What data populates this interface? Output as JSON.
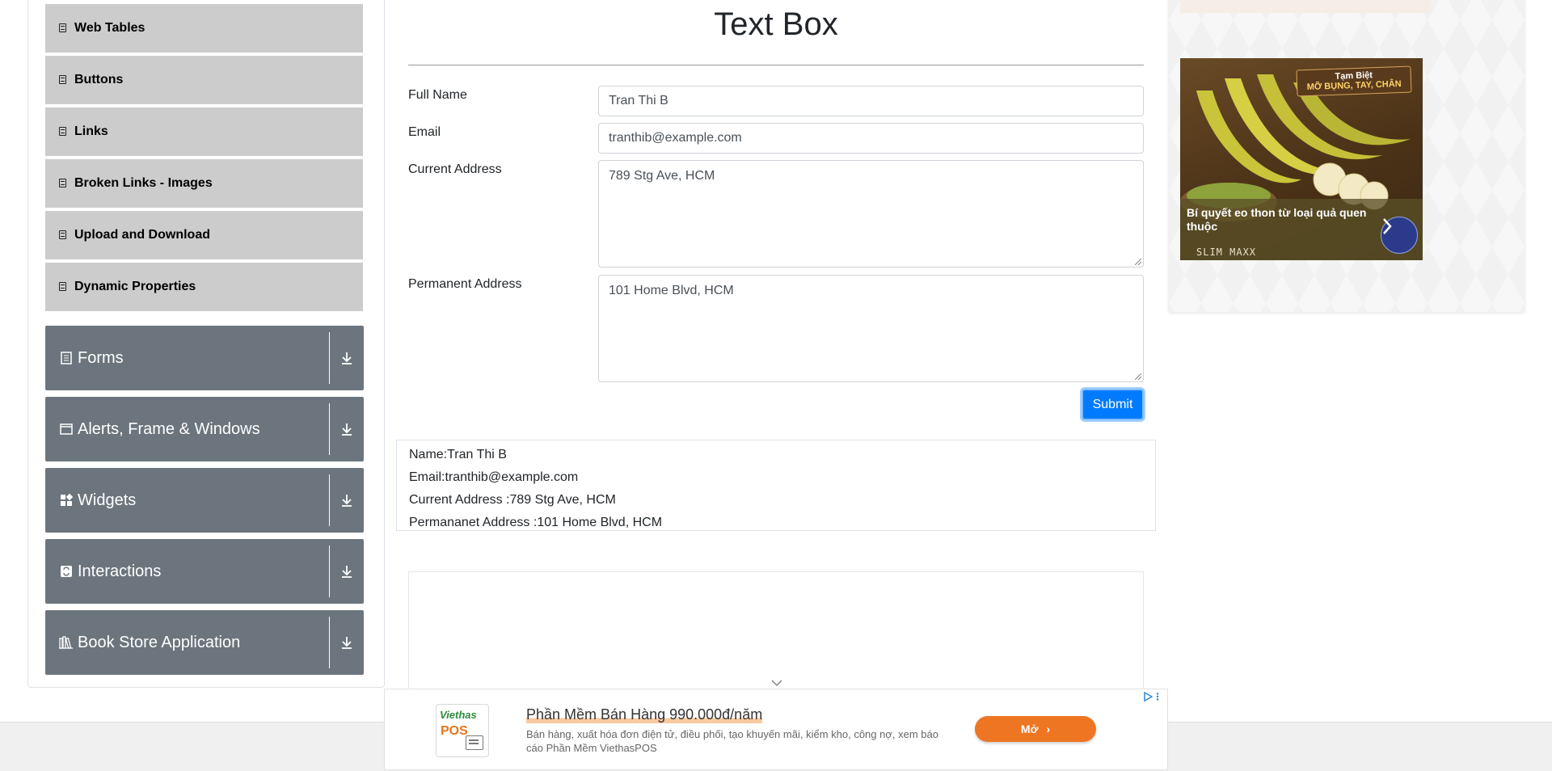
{
  "sidebar": {
    "sub_items": [
      {
        "label": "Web Tables",
        "icon": "element-icon"
      },
      {
        "label": "Buttons",
        "icon": "element-icon"
      },
      {
        "label": "Links",
        "icon": "element-icon"
      },
      {
        "label": "Broken Links - Images",
        "icon": "element-icon"
      },
      {
        "label": "Upload and Download",
        "icon": "element-icon"
      },
      {
        "label": "Dynamic Properties",
        "icon": "element-icon"
      }
    ],
    "groups": [
      {
        "label": "Forms",
        "icon": "document-icon"
      },
      {
        "label": "Alerts, Frame & Windows",
        "icon": "window-icon"
      },
      {
        "label": "Widgets",
        "icon": "widgets-icon"
      },
      {
        "label": "Interactions",
        "icon": "interactions-icon"
      },
      {
        "label": "Book Store Application",
        "icon": "books-icon"
      }
    ]
  },
  "form": {
    "title": "Text Box",
    "full_name": {
      "label": "Full Name",
      "value": "Tran Thi B"
    },
    "email": {
      "label": "Email",
      "value": "tranthib@example.com"
    },
    "current_address": {
      "label": "Current Address",
      "value": "789 Stg Ave, HCM"
    },
    "permanent_address": {
      "label": "Permanent Address",
      "value": "101 Home Blvd, HCM"
    },
    "submit_label": "Submit"
  },
  "output": {
    "name": "Name:Tran Thi B",
    "email": "Email:tranthib@example.com",
    "current_address": "Current Address :789 Stg Ave, HCM",
    "permanent_address": "Permananet Address :101 Home Blvd, HCM"
  },
  "right_ad": {
    "tag_line1": "Tạm Biệt",
    "tag_line2": "MỠ BỤNG, TAY, CHÂN",
    "caption": "Bí quyết eo thon từ loại quả quen thuộc",
    "brand": "SLIM MAXX"
  },
  "bottom_ad": {
    "logo_line1": "Viethas",
    "logo_line2": "POS",
    "headline": "Phần Mềm Bán Hàng 990.000đ/năm",
    "description": "Bán hàng, xuất hóa đơn điện tử, điều phối, tạo khuyến mãi, kiểm kho, công nợ, xem báo cáo Phần Mềm ViethasPOS",
    "button_label": "Mở"
  },
  "colors": {
    "sidebar_sub_bg": "#cccccc",
    "sidebar_group_bg": "#6c757d",
    "primary": "#007bff",
    "ad_button": "#ee7622"
  }
}
